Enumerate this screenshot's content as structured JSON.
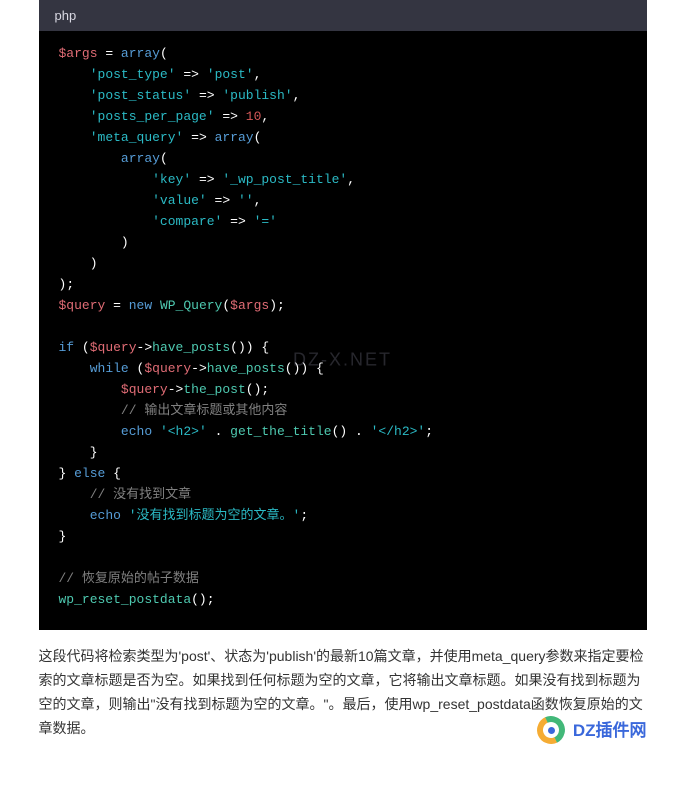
{
  "header": {
    "language": "php"
  },
  "code": {
    "lines": [
      [
        [
          "s-var",
          "$args"
        ],
        [
          "s-eq",
          " = "
        ],
        [
          "s-kw",
          "array"
        ],
        [
          "s-paren",
          "("
        ]
      ],
      [
        [
          "",
          "    "
        ],
        [
          "s-str",
          "'post_type'"
        ],
        [
          "s-fat",
          " => "
        ],
        [
          "s-str",
          "'post'"
        ],
        [
          "s-punc",
          ","
        ]
      ],
      [
        [
          "",
          "    "
        ],
        [
          "s-str",
          "'post_status'"
        ],
        [
          "s-fat",
          " => "
        ],
        [
          "s-str",
          "'publish'"
        ],
        [
          "s-punc",
          ","
        ]
      ],
      [
        [
          "",
          "    "
        ],
        [
          "s-str",
          "'posts_per_page'"
        ],
        [
          "s-fat",
          " => "
        ],
        [
          "s-num",
          "10"
        ],
        [
          "s-punc",
          ","
        ]
      ],
      [
        [
          "",
          "    "
        ],
        [
          "s-str",
          "'meta_query'"
        ],
        [
          "s-fat",
          " => "
        ],
        [
          "s-kw",
          "array"
        ],
        [
          "s-paren",
          "("
        ]
      ],
      [
        [
          "",
          "        "
        ],
        [
          "s-kw",
          "array"
        ],
        [
          "s-paren",
          "("
        ]
      ],
      [
        [
          "",
          "            "
        ],
        [
          "s-str",
          "'key'"
        ],
        [
          "s-fat",
          " => "
        ],
        [
          "s-str",
          "'_wp_post_title'"
        ],
        [
          "s-punc",
          ","
        ]
      ],
      [
        [
          "",
          "            "
        ],
        [
          "s-str",
          "'value'"
        ],
        [
          "s-fat",
          " => "
        ],
        [
          "s-str",
          "''"
        ],
        [
          "s-punc",
          ","
        ]
      ],
      [
        [
          "",
          "            "
        ],
        [
          "s-str",
          "'compare'"
        ],
        [
          "s-fat",
          " => "
        ],
        [
          "s-str",
          "'='"
        ]
      ],
      [
        [
          "",
          "        "
        ],
        [
          "s-paren",
          ")"
        ]
      ],
      [
        [
          "",
          "    "
        ],
        [
          "s-paren",
          ")"
        ]
      ],
      [
        [
          "s-paren",
          ")"
        ],
        [
          "s-semi",
          ";"
        ]
      ],
      [
        [
          "s-var",
          "$query"
        ],
        [
          "s-eq",
          " = "
        ],
        [
          "s-new",
          "new"
        ],
        [
          "",
          " "
        ],
        [
          "s-cls",
          "WP_Query"
        ],
        [
          "s-paren",
          "("
        ],
        [
          "s-var",
          "$args"
        ],
        [
          "s-paren",
          ")"
        ],
        [
          "s-semi",
          ";"
        ]
      ],
      [
        [
          "",
          ""
        ]
      ],
      [
        [
          "s-kw",
          "if"
        ],
        [
          "s-paren",
          " ("
        ],
        [
          "s-var",
          "$query"
        ],
        [
          "s-arrow",
          "->"
        ],
        [
          "s-meth",
          "have_posts"
        ],
        [
          "s-paren",
          "()"
        ],
        [
          "s-paren",
          ") "
        ],
        [
          "s-brace",
          "{"
        ]
      ],
      [
        [
          "",
          "    "
        ],
        [
          "s-kw",
          "while"
        ],
        [
          "s-paren",
          " ("
        ],
        [
          "s-var",
          "$query"
        ],
        [
          "s-arrow",
          "->"
        ],
        [
          "s-meth",
          "have_posts"
        ],
        [
          "s-paren",
          "()"
        ],
        [
          "s-paren",
          ") "
        ],
        [
          "s-brace",
          "{"
        ]
      ],
      [
        [
          "",
          "        "
        ],
        [
          "s-var",
          "$query"
        ],
        [
          "s-arrow",
          "->"
        ],
        [
          "s-meth",
          "the_post"
        ],
        [
          "s-paren",
          "()"
        ],
        [
          "s-semi",
          ";"
        ]
      ],
      [
        [
          "",
          "        "
        ],
        [
          "s-comm",
          "// 输出文章标题或其他内容"
        ]
      ],
      [
        [
          "",
          "        "
        ],
        [
          "s-echo",
          "echo"
        ],
        [
          "",
          " "
        ],
        [
          "s-str",
          "'<h2>'"
        ],
        [
          "s-dot",
          " . "
        ],
        [
          "s-meth",
          "get_the_title"
        ],
        [
          "s-paren",
          "()"
        ],
        [
          "s-dot",
          " . "
        ],
        [
          "s-str",
          "'</h2>'"
        ],
        [
          "s-semi",
          ";"
        ]
      ],
      [
        [
          "",
          "    "
        ],
        [
          "s-brace",
          "}"
        ]
      ],
      [
        [
          "s-brace",
          "}"
        ],
        [
          "",
          " "
        ],
        [
          "s-kw",
          "else"
        ],
        [
          "",
          " "
        ],
        [
          "s-brace",
          "{"
        ]
      ],
      [
        [
          "",
          "    "
        ],
        [
          "s-comm",
          "// 没有找到文章"
        ]
      ],
      [
        [
          "",
          "    "
        ],
        [
          "s-echo",
          "echo"
        ],
        [
          "",
          " "
        ],
        [
          "s-str",
          "'没有找到标题为空的文章。'"
        ],
        [
          "s-semi",
          ";"
        ]
      ],
      [
        [
          "s-brace",
          "}"
        ]
      ],
      [
        [
          "",
          ""
        ]
      ],
      [
        [
          "s-comm",
          "// 恢复原始的帖子数据"
        ]
      ],
      [
        [
          "s-meth",
          "wp_reset_postdata"
        ],
        [
          "s-paren",
          "()"
        ],
        [
          "s-semi",
          ";"
        ]
      ]
    ]
  },
  "description": "这段代码将检索类型为'post'、状态为'publish'的最新10篇文章，并使用meta_query参数来指定要检索的文章标题是否为空。如果找到任何标题为空的文章，它将输出文章标题。如果没有找到标题为空的文章，则输出\"没有找到标题为空的文章。\"。最后，使用wp_reset_postdata函数恢复原始的文章数据。",
  "watermark": {
    "center": "DZ-X.NET",
    "brand": "DZ插件网"
  }
}
